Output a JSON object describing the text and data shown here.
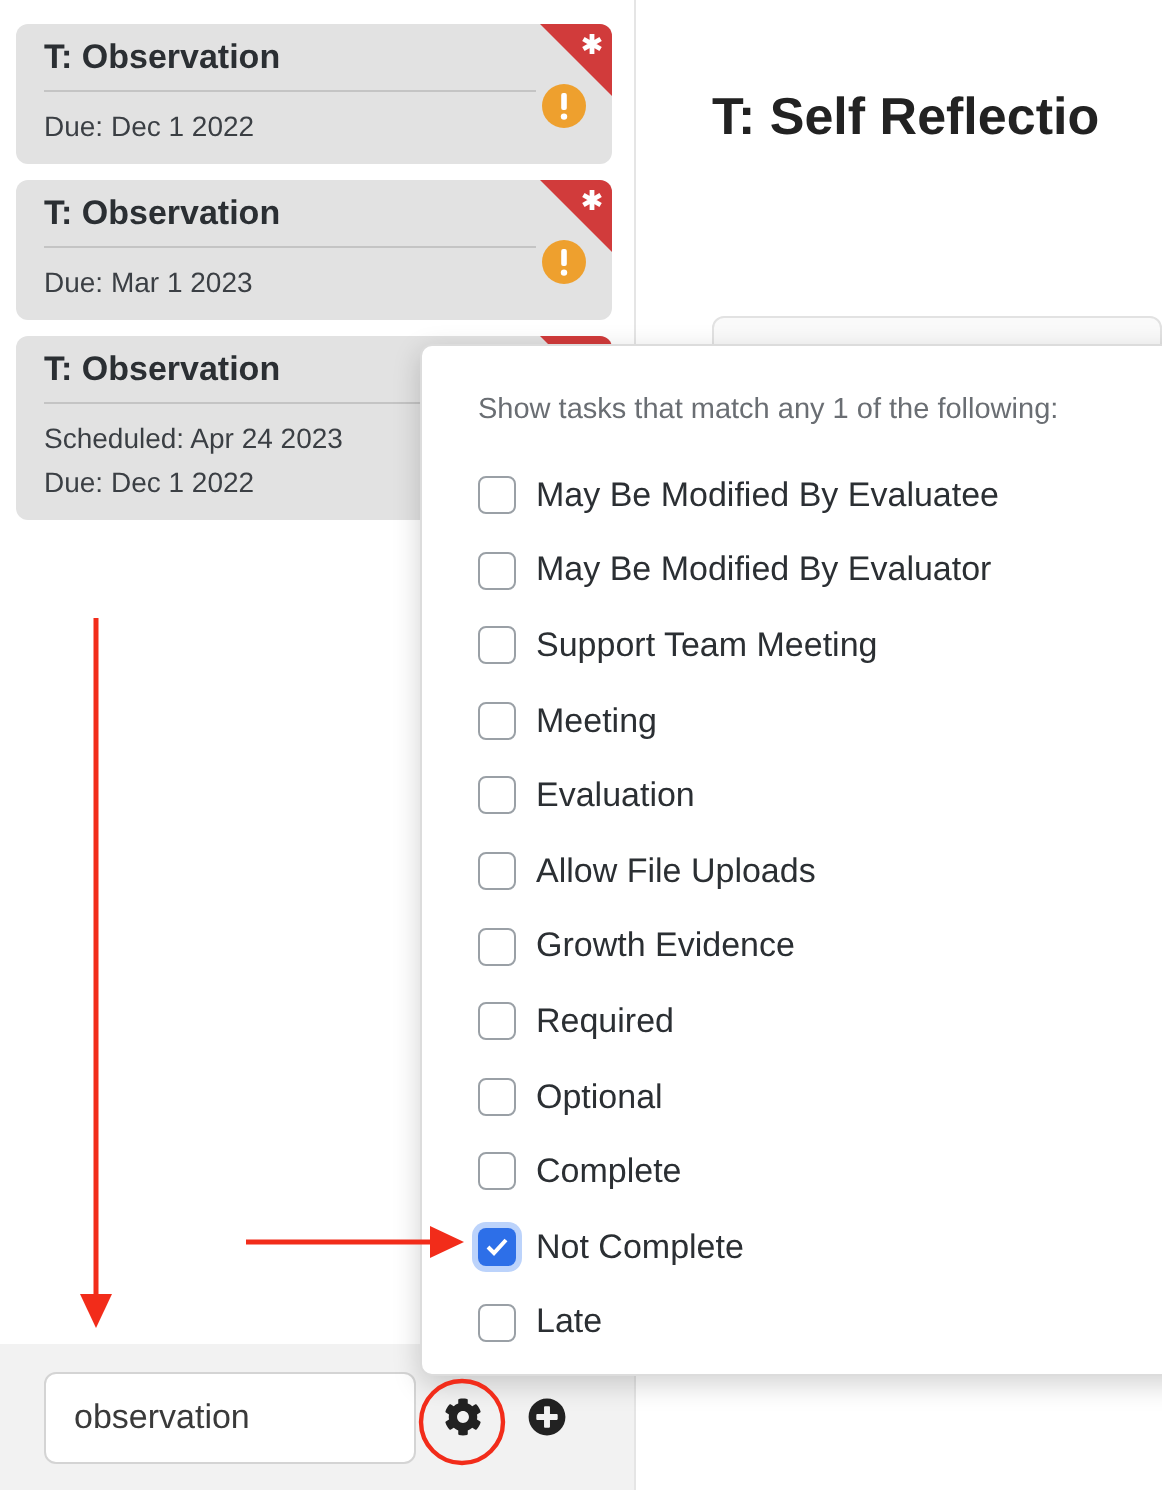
{
  "tasks": [
    {
      "title": "T: Observation",
      "lines": [
        "Due: Dec 1 2022"
      ],
      "flagged": true,
      "warning": true
    },
    {
      "title": "T: Observation",
      "lines": [
        "Due: Mar 1 2023"
      ],
      "flagged": true,
      "warning": true
    },
    {
      "title": "T: Observation",
      "lines": [
        "Scheduled: Apr 24 2023",
        "Due: Dec 1 2022"
      ],
      "flagged": true
    }
  ],
  "heading": "T: Self Reflectio",
  "filter": {
    "intro": "Show tasks that match any 1 of the following:",
    "options": [
      {
        "label": "May Be Modified By Evaluatee",
        "checked": false
      },
      {
        "label": "May Be Modified By Evaluator",
        "checked": false
      },
      {
        "label": "Support Team Meeting",
        "checked": false
      },
      {
        "label": "Meeting",
        "checked": false
      },
      {
        "label": "Evaluation",
        "checked": false
      },
      {
        "label": "Allow File Uploads",
        "checked": false
      },
      {
        "label": "Growth Evidence",
        "checked": false
      },
      {
        "label": "Required",
        "checked": false
      },
      {
        "label": "Optional",
        "checked": false
      },
      {
        "label": "Complete",
        "checked": false
      },
      {
        "label": "Not Complete",
        "checked": true
      },
      {
        "label": "Late",
        "checked": false
      }
    ]
  },
  "search": {
    "value": "observation"
  }
}
